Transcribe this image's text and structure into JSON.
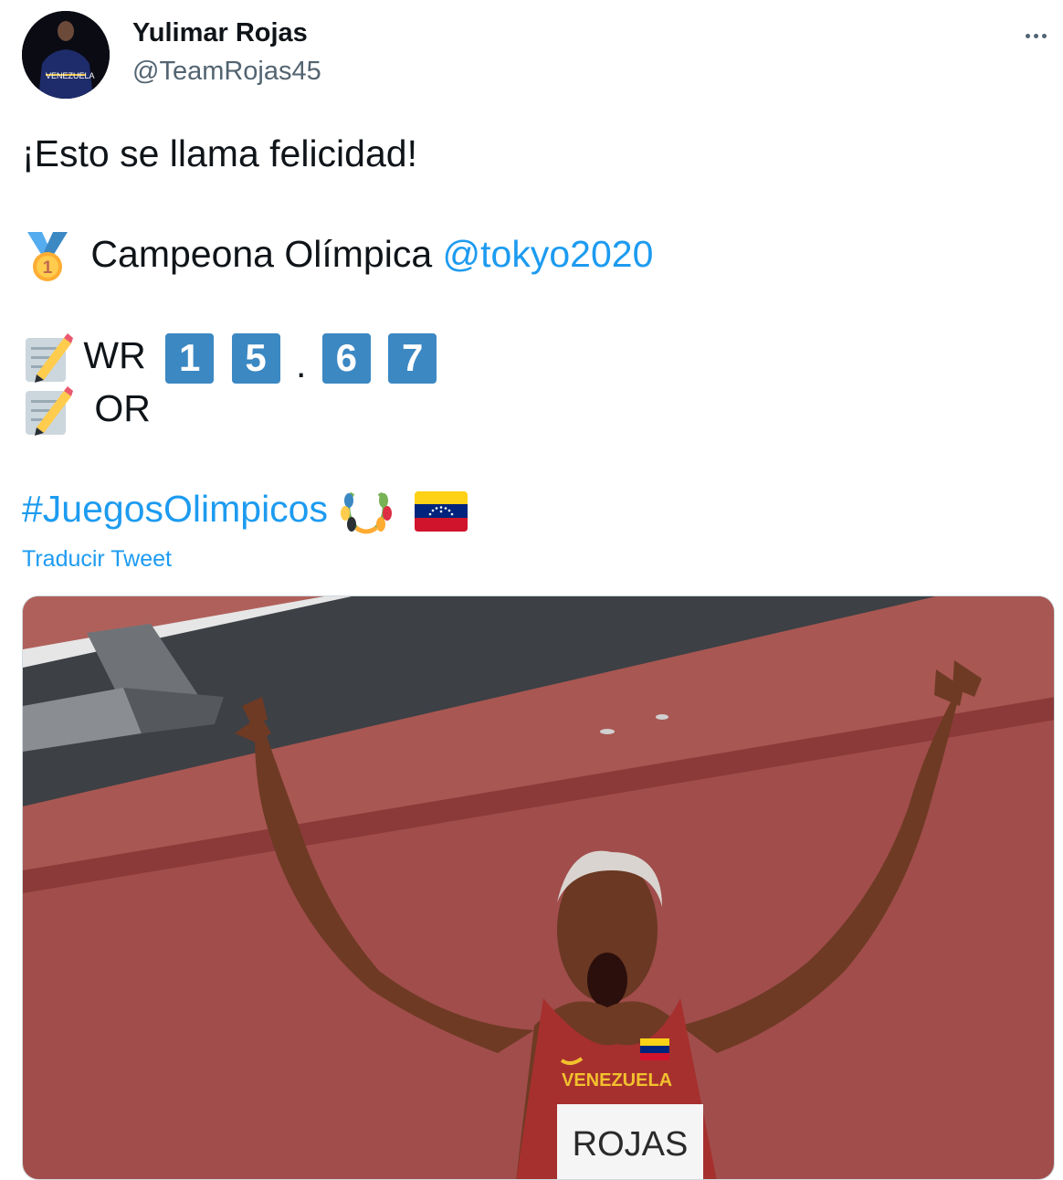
{
  "author": {
    "name": "Yulimar Rojas",
    "handle": "@TeamRojas45",
    "avatar_text": "VENEZUELA"
  },
  "tweet": {
    "line1": "¡Esto se llama felicidad!",
    "line2_text": "Campeona Olímpica",
    "line2_mention": "@tokyo2020",
    "line3_label": "WR",
    "record_digits": [
      "1",
      "5",
      "6",
      "7"
    ],
    "record_sep": ".",
    "line4_label": "OR",
    "hashtag": "#JuegosOlimpicos",
    "translate": "Traducir Tweet"
  },
  "media": {
    "bib_name": "ROJAS",
    "jersey_text": "VENEZUELA"
  },
  "icons": {
    "medal": "gold-medal-icon",
    "memo": "memo-icon",
    "laurel": "laurel-wreath-icon",
    "flag": "venezuela-flag-icon",
    "more": "more-dots-icon"
  },
  "colors": {
    "link": "#1d9bf0",
    "keycap": "#3b88c3",
    "track": "#a04d4b"
  }
}
